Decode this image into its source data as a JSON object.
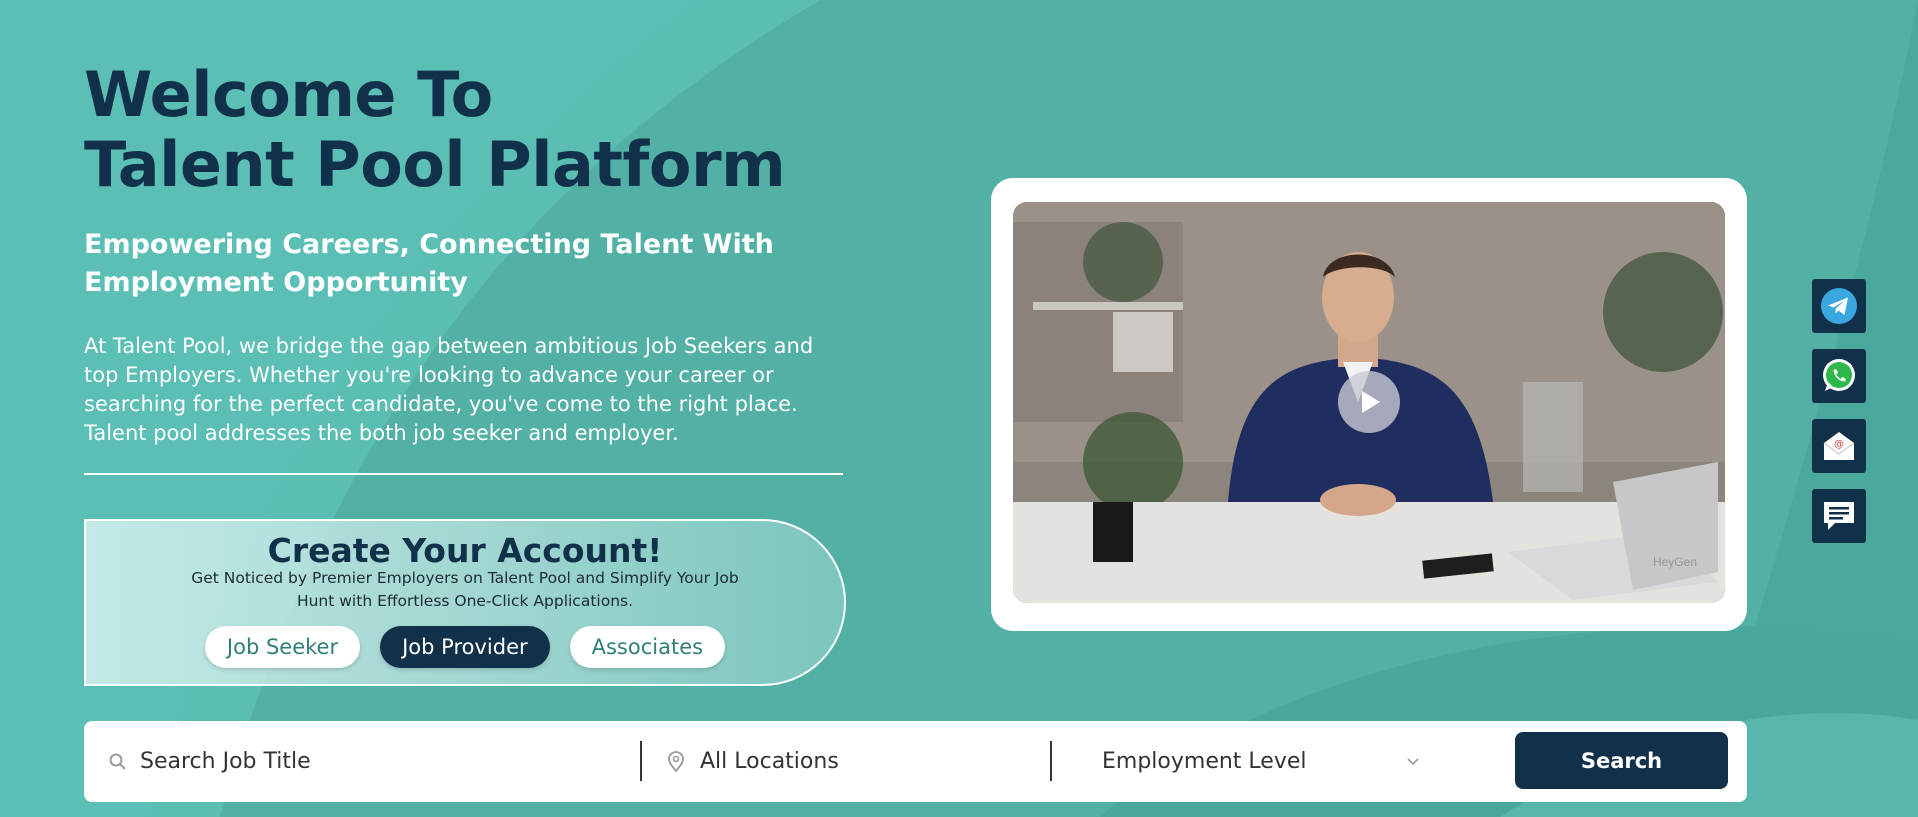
{
  "hero": {
    "title_line1": "Welcome To",
    "title_line2": "Talent Pool Platform",
    "subtitle_line1": "Empowering Careers, Connecting Talent With",
    "subtitle_line2": "Employment Opportunity",
    "description": "At Talent Pool, we bridge the gap between ambitious Job Seekers and top Employers. Whether you're looking to advance your career or searching for the perfect candidate, you've come to the right place. Talent pool addresses the both job seeker and employer."
  },
  "account": {
    "title": "Create Your Account!",
    "description": "Get Noticed by Premier Employers on Talent Pool and Simplify Your Job Hunt with Effortless One-Click Applications.",
    "buttons": {
      "job_seeker": "Job Seeker",
      "job_provider": "Job Provider",
      "associates": "Associates"
    }
  },
  "video": {
    "watermark": "HeyGen",
    "play_icon": "play-icon"
  },
  "social": [
    {
      "name": "telegram",
      "icon": "telegram-icon"
    },
    {
      "name": "whatsapp",
      "icon": "whatsapp-icon"
    },
    {
      "name": "email",
      "icon": "email-icon"
    },
    {
      "name": "chat",
      "icon": "chat-icon"
    }
  ],
  "search": {
    "job_title_placeholder": "Search Job Title",
    "location_placeholder": "All Locations",
    "employment_level": "Employment Level",
    "button_label": "Search"
  },
  "colors": {
    "background": "#53b1a6",
    "navy": "#11304a",
    "accent_teal": "#2f7f78"
  }
}
